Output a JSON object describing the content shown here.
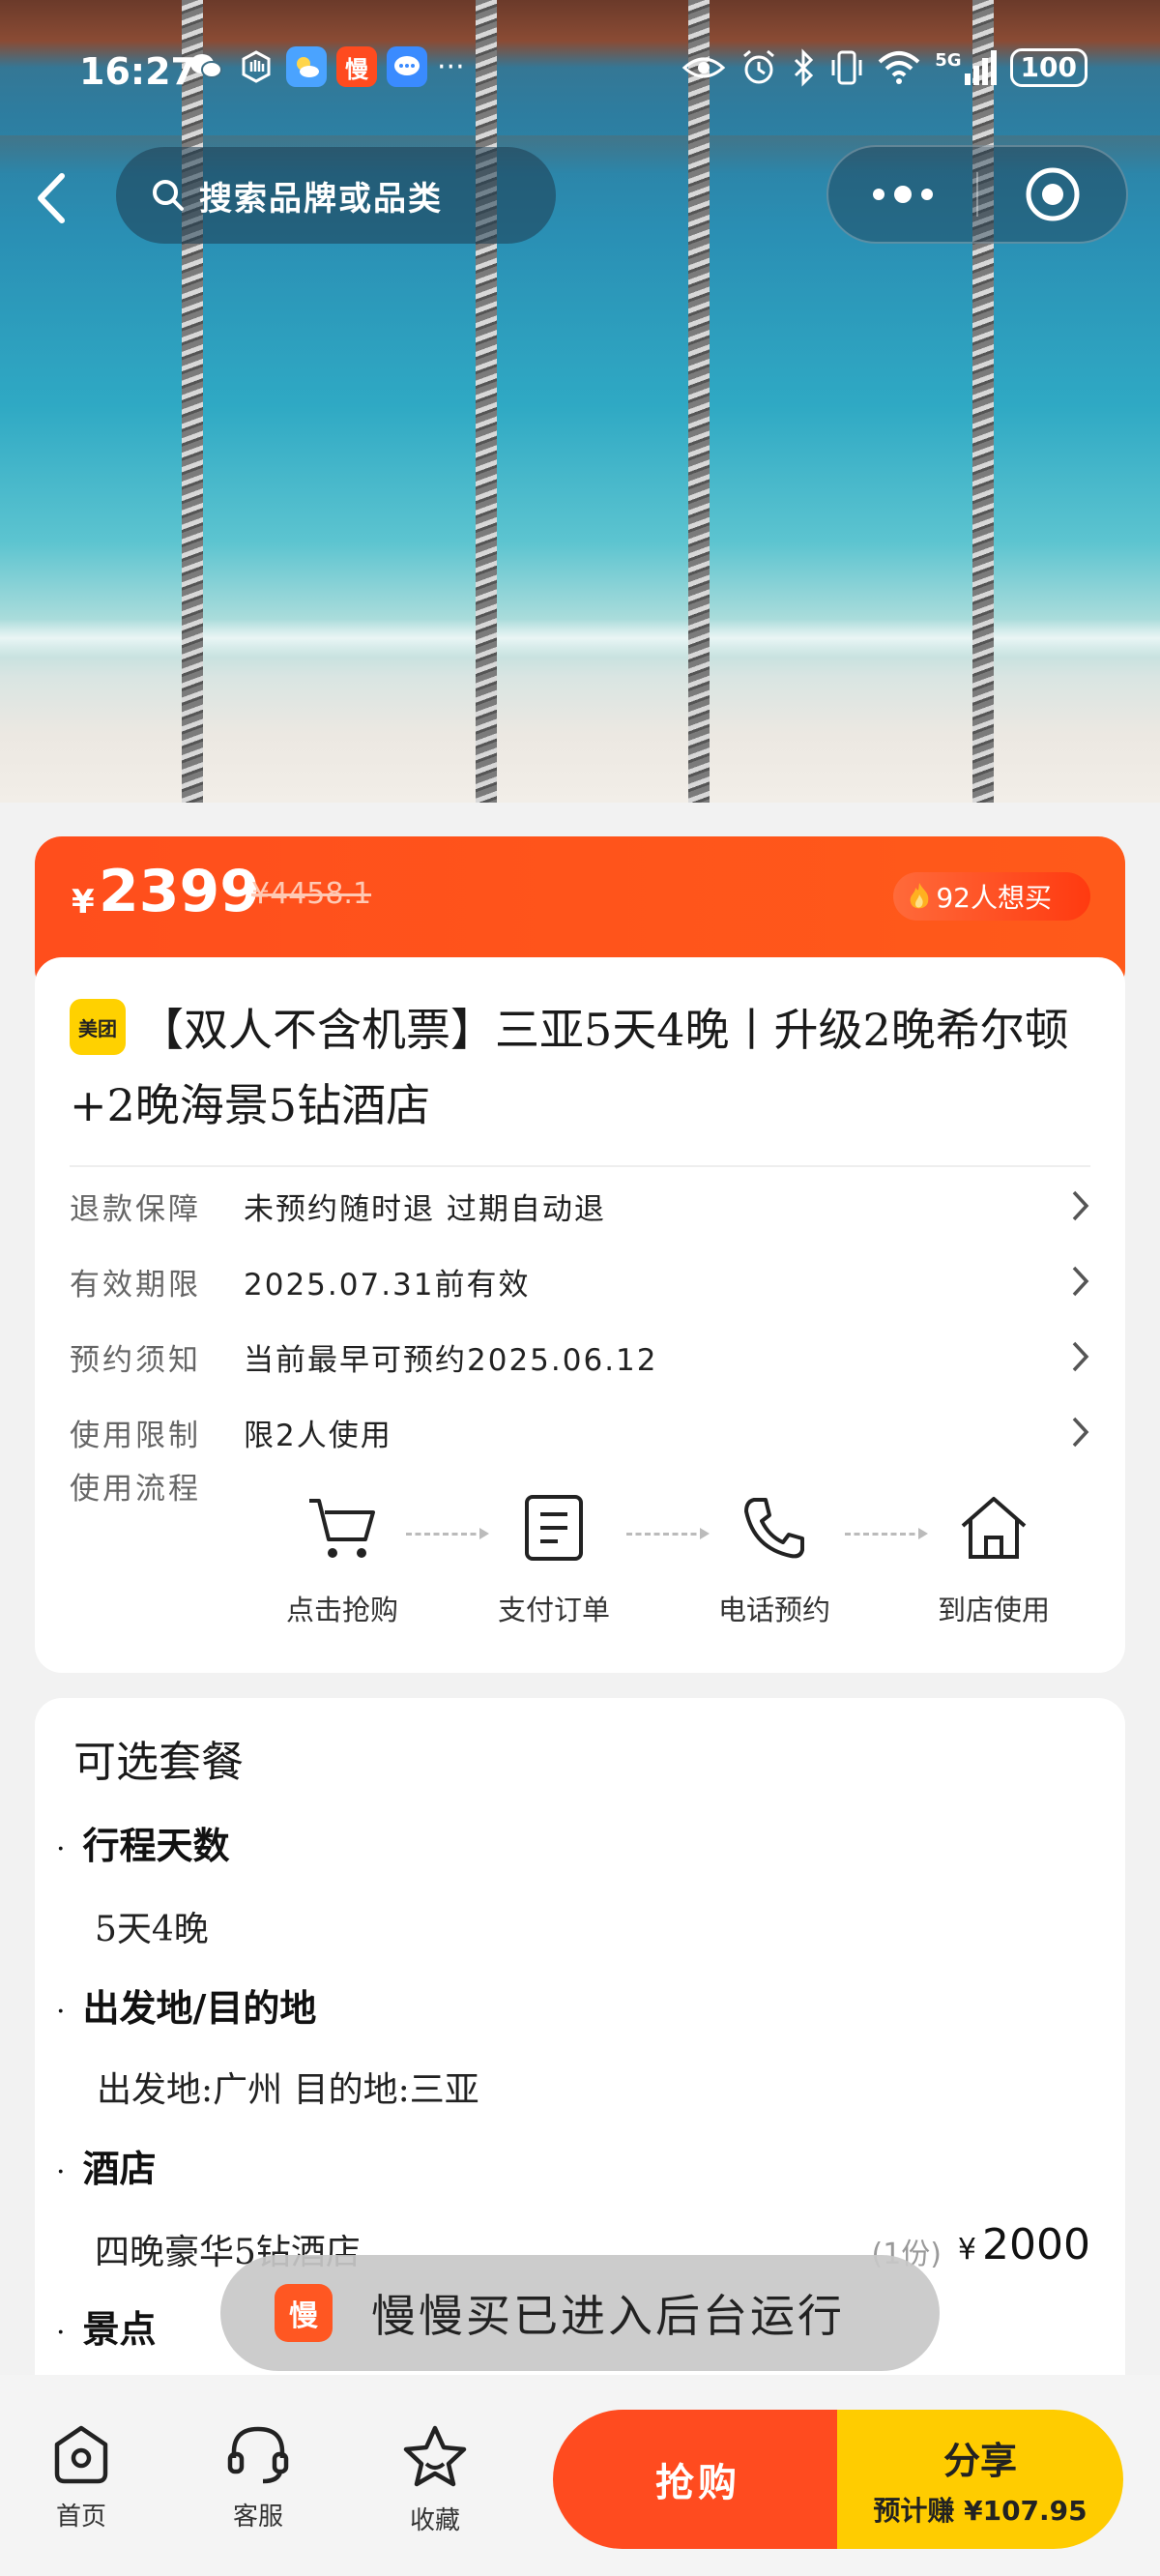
{
  "status_bar": {
    "time": "16:27",
    "app_badge": "慢",
    "network": "5G",
    "battery": "100"
  },
  "top_nav": {
    "search_placeholder": "搜索品牌或品类"
  },
  "price": {
    "currency": "¥",
    "current": "2399",
    "original": "¥4458.1",
    "want_count": "92人想买"
  },
  "product": {
    "brand_badge": "美团",
    "title": "【双人不含机票】三亚5天4晚丨升级2晚希尔顿+2晚海景5钻酒店"
  },
  "details": [
    {
      "label": "退款保障",
      "value": "未预约随时退 过期自动退"
    },
    {
      "label": "有效期限",
      "value": "2025.07.31前有效"
    },
    {
      "label": "预约须知",
      "value": "当前最早可预约2025.06.12"
    },
    {
      "label": "使用限制",
      "value": "限2人使用"
    }
  ],
  "flow": {
    "label": "使用流程",
    "steps": [
      "点击抢购",
      "支付订单",
      "电话预约",
      "到店使用"
    ]
  },
  "packages": {
    "heading": "可选套餐",
    "sections": [
      {
        "title": "行程天数",
        "item": "5天4晚"
      },
      {
        "title": "出发地/目的地",
        "item": "出发地:广州 目的地:三亚"
      },
      {
        "title": "酒店",
        "item": "四晚豪华5钻酒店",
        "qty": "(1份)",
        "currency": "¥",
        "price": "2000"
      },
      {
        "title": "景点"
      }
    ]
  },
  "toast": {
    "logo": "慢",
    "message": "慢慢买已进入后台运行"
  },
  "bottom_bar": {
    "home": "首页",
    "service": "客服",
    "favorite": "收藏",
    "buy": "抢购",
    "share": "分享",
    "share_earn": "预计赚 ¥107.95"
  }
}
